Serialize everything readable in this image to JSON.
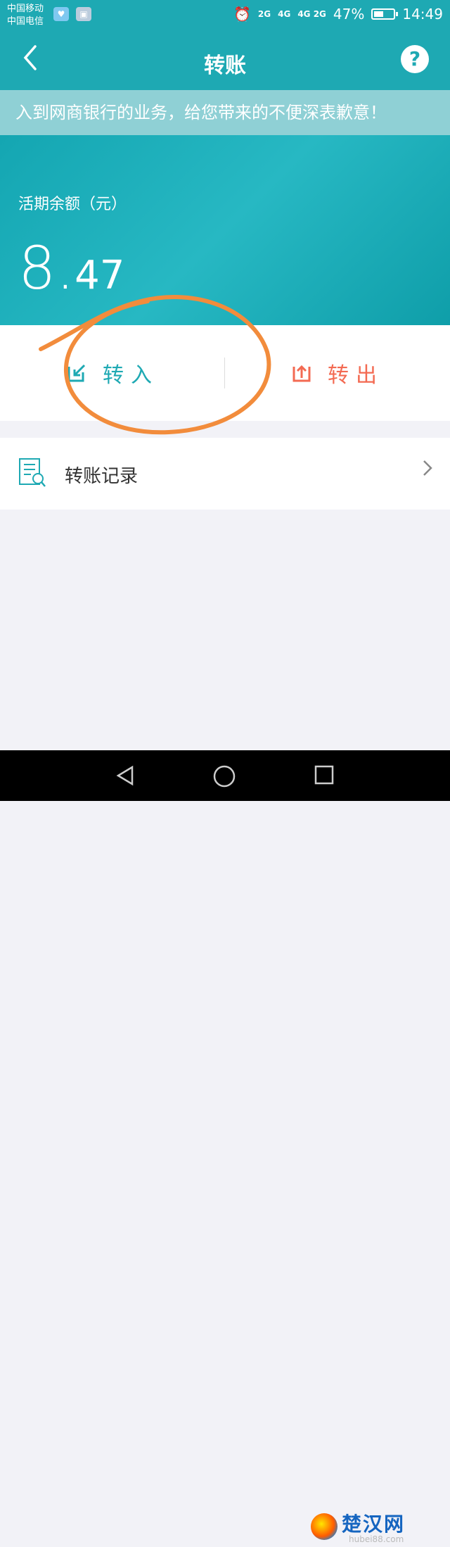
{
  "status_bar": {
    "carrier_1": "中国移动",
    "carrier_2": "中国电信",
    "network_2g": "2G",
    "network_4g": "4G",
    "network_4g2g": "4G 2G",
    "battery": "47%",
    "battery_level": 0.47,
    "time": "14:49"
  },
  "nav": {
    "title": "转账",
    "back_icon": "chevron-left-icon",
    "help_label": "?"
  },
  "notice": {
    "text": "入到网商银行的业务，给您带来的不便深表歉意！"
  },
  "balance": {
    "label": "活期余额（元）",
    "integer_part": "8.",
    "decimal_part": "47"
  },
  "actions": {
    "transfer_in_label": "转入",
    "transfer_out_label": "转出",
    "transfer_in_color": "#1ea9b3",
    "transfer_out_color": "#f36a52"
  },
  "records": {
    "label": "转账记录",
    "icon": "document-search-icon"
  },
  "watermark": {
    "text": "楚汉网",
    "sub": "hubei88.com"
  },
  "colors": {
    "primary": "#1ea9b3",
    "annotation": "#f28c3c",
    "background": "#f2f2f7"
  }
}
